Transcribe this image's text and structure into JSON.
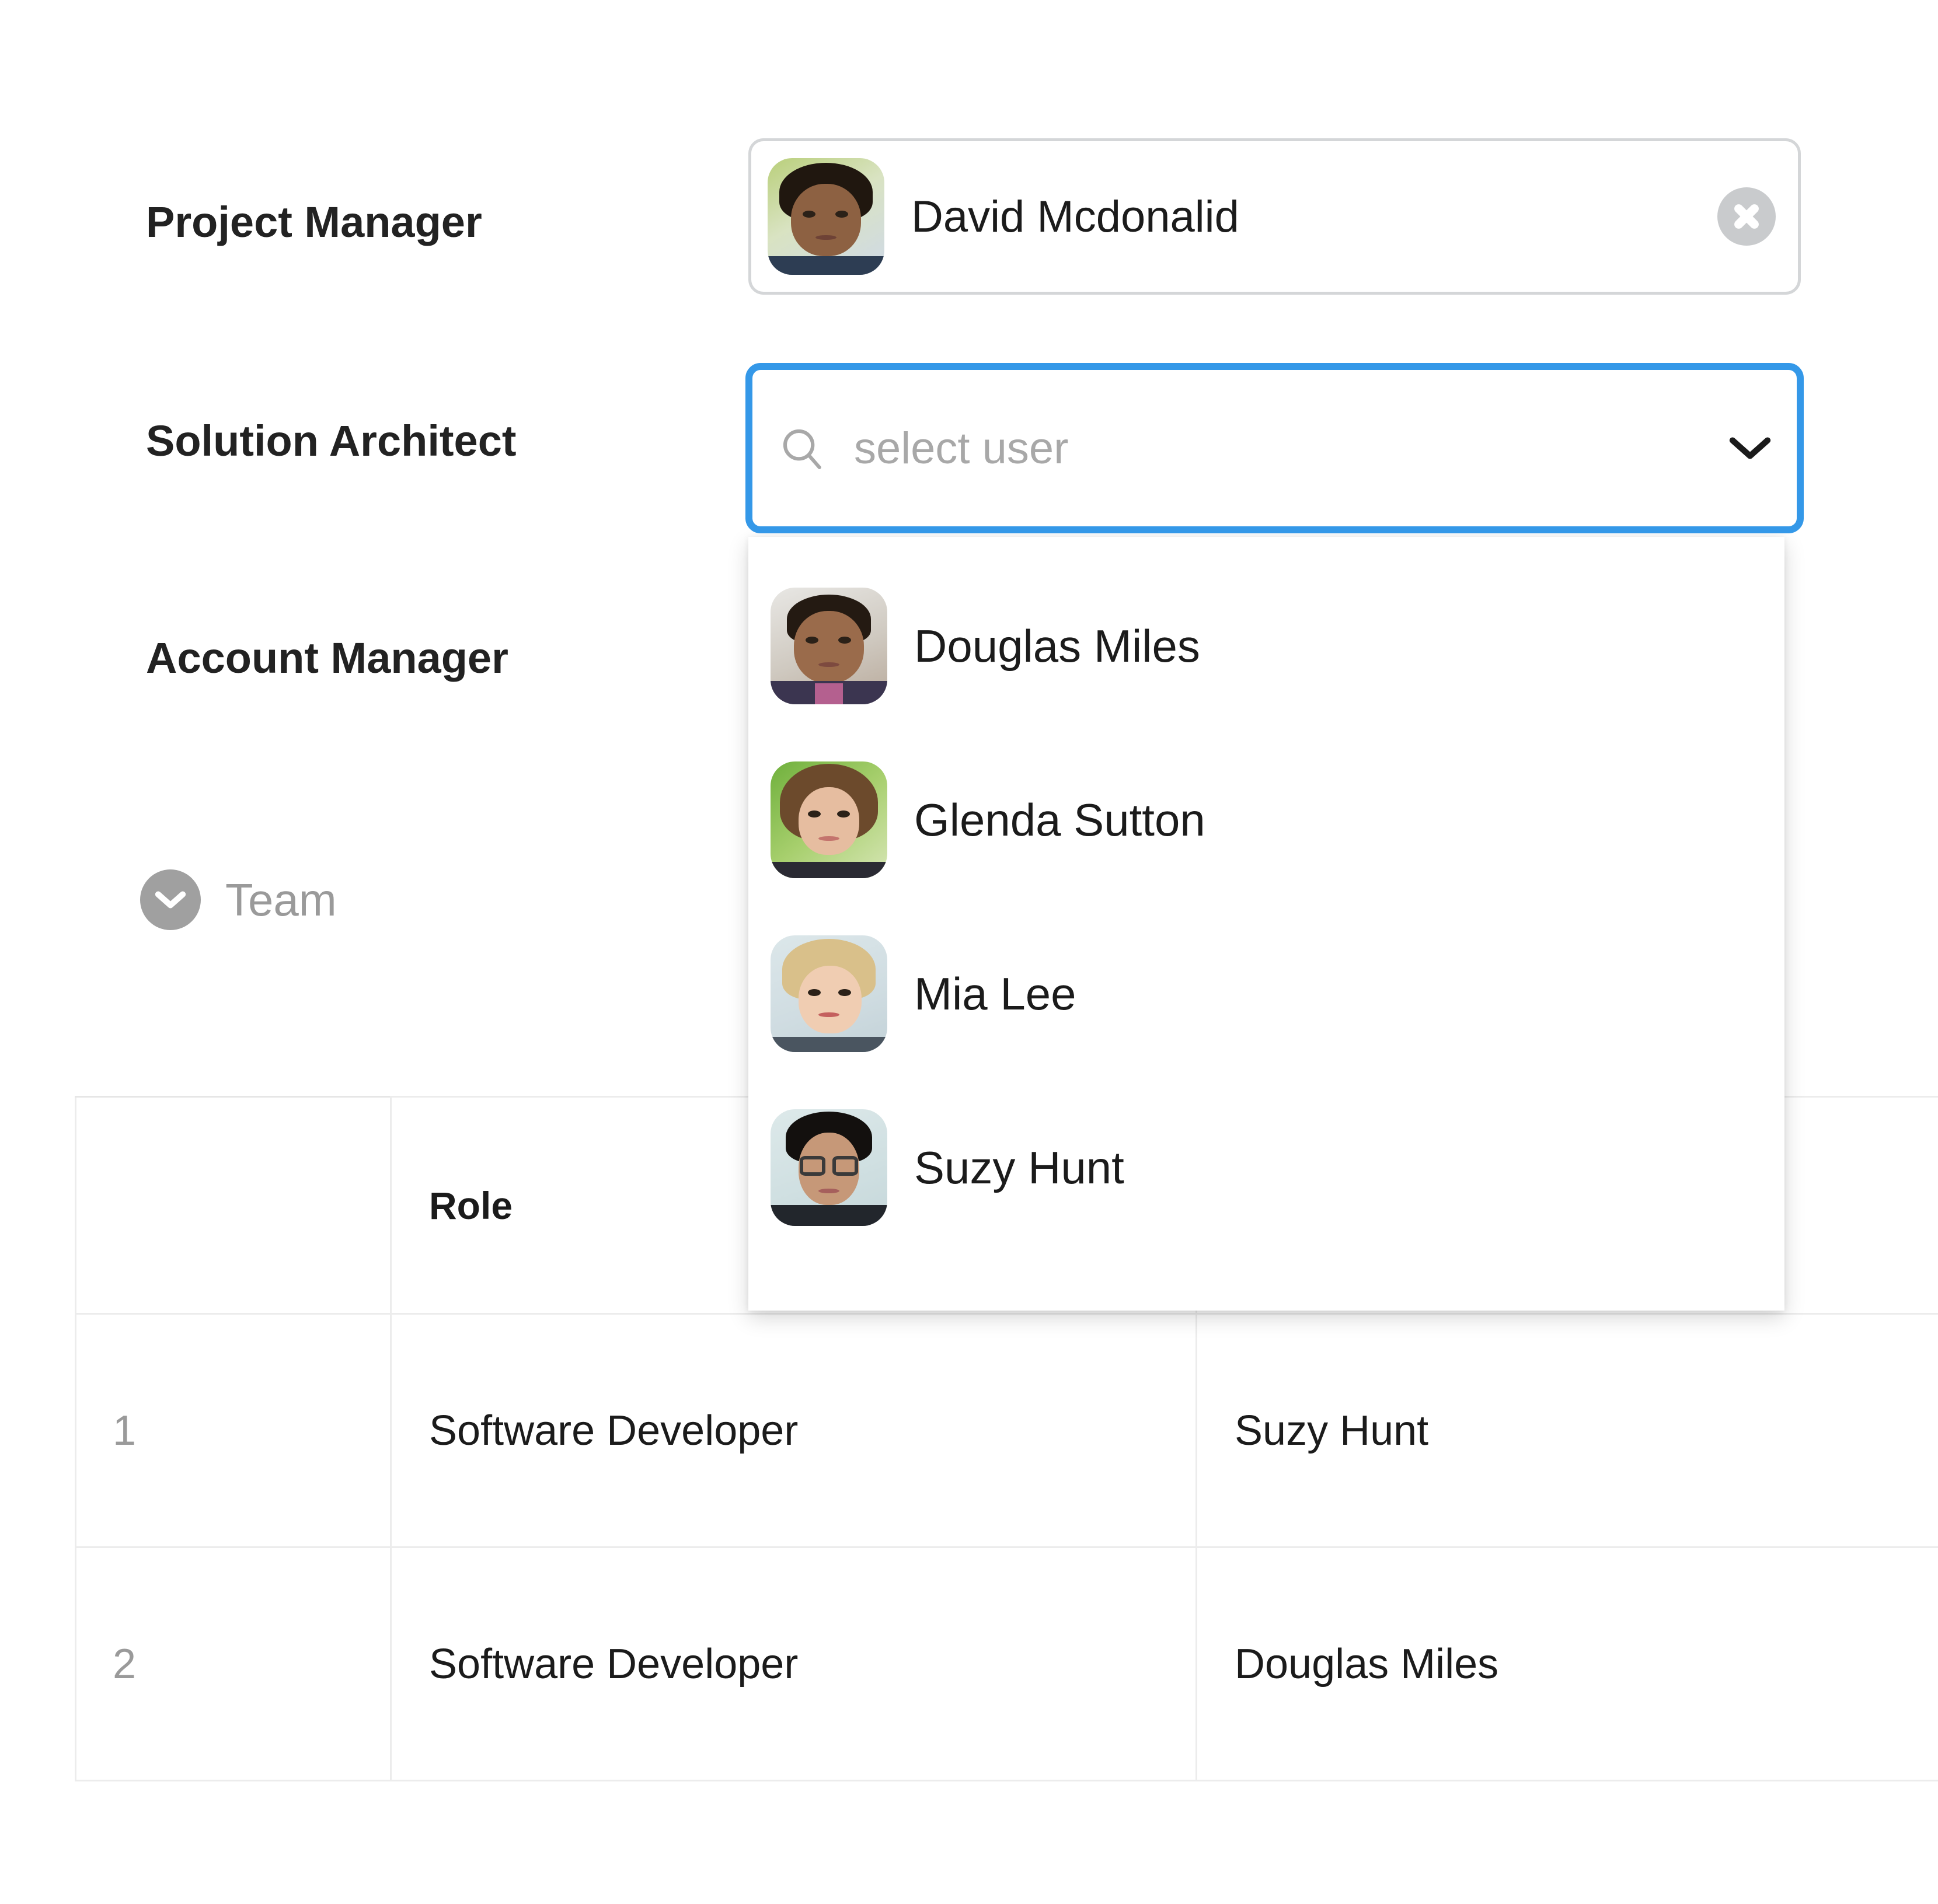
{
  "form": {
    "fields": [
      {
        "label": "Project Manager",
        "type": "user-chip",
        "value": "David Mcdonalid",
        "clear_icon": "close-icon"
      },
      {
        "label": "Solution Architect",
        "type": "user-search",
        "value": "",
        "placeholder": "select user",
        "search_icon": "search-icon",
        "chevron_icon": "chevron-down-icon",
        "focused": true
      },
      {
        "label": "Account Manager",
        "type": "user-select",
        "value": ""
      }
    ]
  },
  "dropdown": {
    "visible": true,
    "options": [
      {
        "name": "Douglas Miles"
      },
      {
        "name": "Glenda Sutton"
      },
      {
        "name": "Mia Lee"
      },
      {
        "name": "Suzy Hunt"
      }
    ]
  },
  "team_section": {
    "toggle_icon": "chevron-down-circle-icon",
    "title": "Team",
    "expanded": true
  },
  "team_table": {
    "columns": [
      "",
      "Role",
      "",
      ""
    ],
    "rows": [
      {
        "index": "1",
        "role": "Software Developer",
        "member": "Suzy Hunt"
      },
      {
        "index": "2",
        "role": "Software Developer",
        "member": "Douglas Miles"
      }
    ]
  },
  "colors": {
    "focus_blue": "#3498e8",
    "border_gray": "#d4d6d8",
    "placeholder_gray": "#a8a8a8",
    "muted_gray": "#9a9a9a",
    "text_dark": "#1b1b1b",
    "table_border": "#ececec",
    "clear_button_gray": "#c9cbcd"
  }
}
